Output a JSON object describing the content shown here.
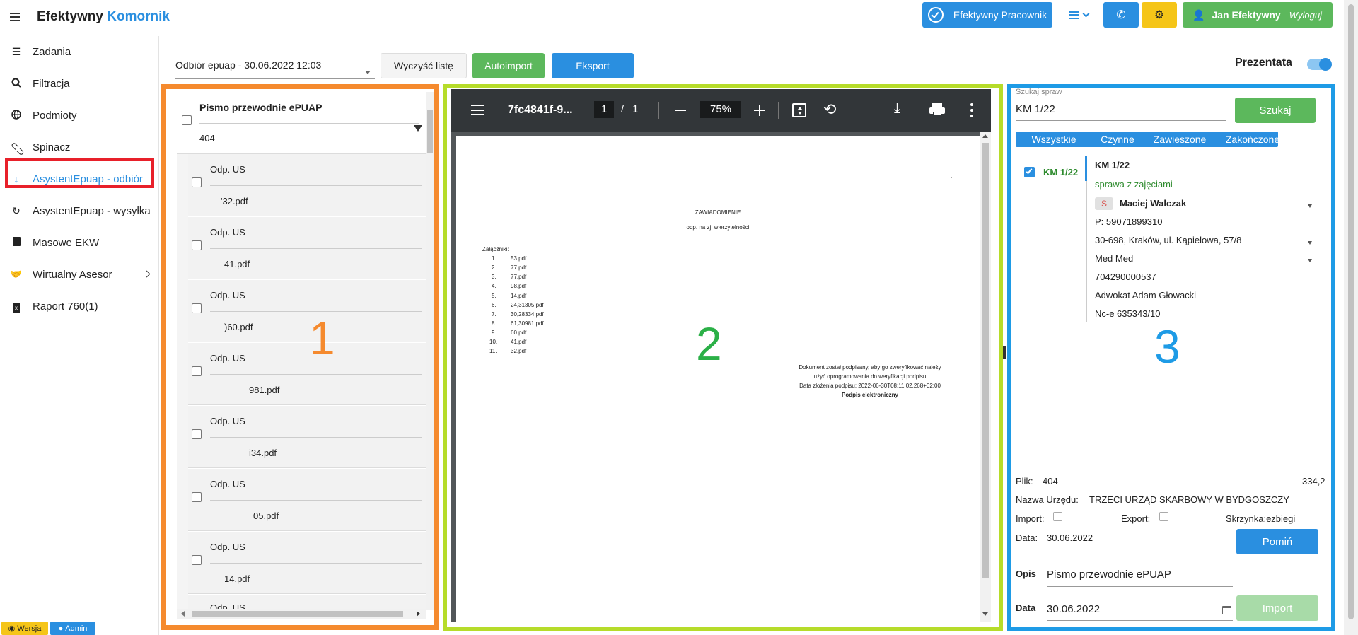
{
  "header": {
    "brand_part1": "Efektywny",
    "brand_part2": "Komornik",
    "btn_pracownik": "Efektywny Pracownik",
    "user_name": "Jan Efektywny",
    "logout": "Wyloguj"
  },
  "sidebar": {
    "items": [
      {
        "label": "Zadania",
        "icon": "list-icon"
      },
      {
        "label": "Filtracja",
        "icon": "search-icon"
      },
      {
        "label": "Podmioty",
        "icon": "globe-icon"
      },
      {
        "label": "Spinacz",
        "icon": "paperclip-icon"
      },
      {
        "label": "AsystentEpuap - odbiór",
        "icon": "arrow-down-icon"
      },
      {
        "label": "AsystentEpuap - wysyłka",
        "icon": "redo-icon"
      },
      {
        "label": "Masowe EKW",
        "icon": "book-icon"
      },
      {
        "label": "Wirtualny Asesor",
        "icon": "handshake-icon"
      },
      {
        "label": "Raport 760(1)",
        "icon": "excel-file-icon"
      }
    ],
    "badge_version": "Wersja",
    "badge_admin": "Admin"
  },
  "toolbar": {
    "select_value": "Odbiór epuap - 30.06.2022 12:03",
    "clear_label": "Wyczyść listę",
    "autoimport_label": "Autoimport",
    "export_label": "Eksport",
    "presenter_label": "Prezentata"
  },
  "panel1": {
    "header_title": "Pismo przewodnie ePUAP",
    "header_sub": "404",
    "number": "1",
    "rows": [
      {
        "title": "Odp. US",
        "file": "'32.pdf"
      },
      {
        "title": "Odp. US",
        "file": "41.pdf"
      },
      {
        "title": "Odp. US",
        "file": ")60.pdf"
      },
      {
        "title": "Odp. US",
        "file": "981.pdf"
      },
      {
        "title": "Odp. US",
        "file": "i34.pdf"
      },
      {
        "title": "Odp. US",
        "file": "05.pdf"
      },
      {
        "title": "Odp. US",
        "file": "14.pdf"
      },
      {
        "title": "Odp. US",
        "file": ""
      }
    ]
  },
  "pdf": {
    "filename": "7fc4841f-9...",
    "page_current": "1",
    "page_sep": "/",
    "page_total": "1",
    "zoom": "75%",
    "number": "2",
    "doc_title": "ZAWIADOMIENIE",
    "doc_subtitle": "odp. na zj. wierzytelności",
    "attachments_label": "Załączniki:",
    "attachments": [
      {
        "n": "1.",
        "f": "53.pdf"
      },
      {
        "n": "2.",
        "f": "77.pdf"
      },
      {
        "n": "3.",
        "f": "77.pdf"
      },
      {
        "n": "4.",
        "f": "98.pdf"
      },
      {
        "n": "5.",
        "f": "14.pdf"
      },
      {
        "n": "6.",
        "f": "24,31305.pdf"
      },
      {
        "n": "7.",
        "f": "30,28334.pdf"
      },
      {
        "n": "8.",
        "f": "61,30981.pdf"
      },
      {
        "n": "9.",
        "f": "60.pdf"
      },
      {
        "n": "10.",
        "f": "41.pdf"
      },
      {
        "n": "11.",
        "f": "32.pdf"
      }
    ],
    "sign_line1": "Dokument został podpisany, aby go zweryfikować należy",
    "sign_line2": "użyć oprogramowania do weryfikacji podpisu",
    "sign_line3": "Data złożenia podpisu: 2022-06-30T08:11:02.268+02:00",
    "sign_line4": "Podpis elektroniczny"
  },
  "panel3": {
    "number": "3",
    "search_label": "Szukaj spraw",
    "search_value": "KM 1/22",
    "search_btn": "Szukaj",
    "tabs": [
      "Wszystkie",
      "Czynne",
      "Zawieszone",
      "Zakończone"
    ],
    "case_sig": "KM 1/22",
    "case_title": "KM 1/22",
    "case_status": "sprawa z zajęciami",
    "party_badge": "S",
    "party_name": "Maciej Walczak",
    "pesel": "P: 59071899310",
    "address": "30-698, Kraków, ul. Kąpielowa, 57/8",
    "creditor": "Med Med",
    "account": "704290000537",
    "lawyer": "Adwokat Adam Głowacki",
    "nc": "Nc-e 635343/10",
    "plik_label": "Plik:",
    "plik_value": "404",
    "plik_right": "334,2",
    "urzad_label": "Nazwa Urzędu:",
    "urzad_value": "TRZECI URZĄD SKARBOWY W BYDGOSZCZY",
    "import_label": "Import:",
    "export_label": "Export:",
    "skrzynka": "Skrzynka:ezbiegi",
    "data_label": "Data:",
    "data_value": "30.06.2022",
    "pomin_btn": "Pomiń",
    "opis_label": "Opis",
    "opis_value": "Pismo przewodnie ePUAP",
    "data2_label": "Data",
    "data2_value": "30.06.2022",
    "import_btn": "Import"
  },
  "colors": {
    "accent": "#2a8fe0",
    "green": "#5cb85c",
    "orange_frame": "#f58a2e",
    "green_frame": "#b6dc2a",
    "blue_frame": "#1e9be6",
    "red_frame": "#e8202a"
  }
}
